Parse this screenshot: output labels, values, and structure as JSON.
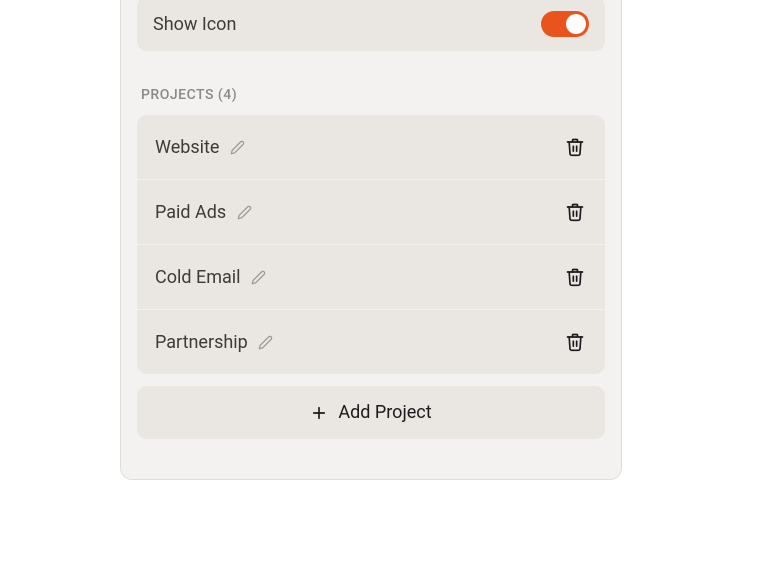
{
  "settings": {
    "show_icon_label": "Show Icon",
    "show_icon_value": true
  },
  "projects": {
    "section_label": "PROJECTS (4)",
    "count": 4,
    "items": [
      {
        "name": "Website"
      },
      {
        "name": "Paid Ads"
      },
      {
        "name": "Cold Email"
      },
      {
        "name": "Partnership"
      }
    ],
    "add_button_label": "Add Project"
  },
  "colors": {
    "accent": "#e8541c",
    "panel_bg": "#f4f2f0",
    "row_bg": "#eae6e2",
    "text": "#3d3b38",
    "muted": "#8b8986"
  }
}
